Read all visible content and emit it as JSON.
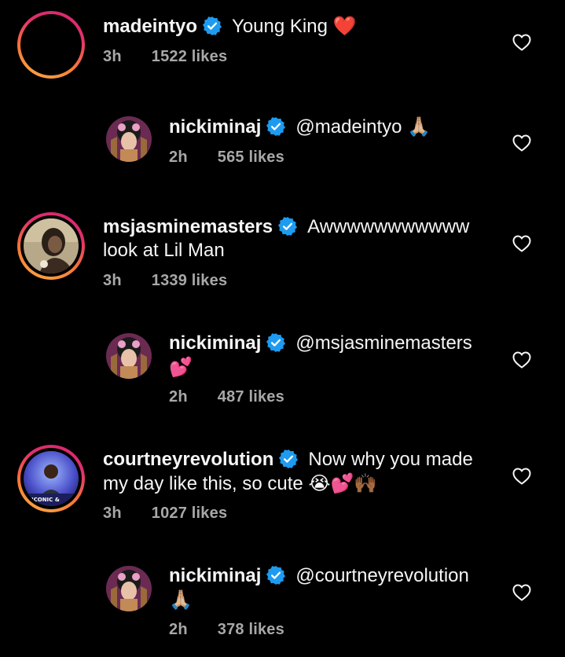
{
  "comments": [
    {
      "username": "madeintyo",
      "text": "Young King",
      "emoji": "❤️",
      "time": "3h",
      "likes": "1522 likes",
      "reply": {
        "username": "nickiminaj",
        "text": "@madeintyo",
        "emoji": "🙏🏼",
        "time": "2h",
        "likes": "565 likes"
      }
    },
    {
      "username": "msjasminemasters",
      "text_line1": "Awwwwwwwwwww",
      "text_line2": "look at Lil Man",
      "time": "3h",
      "likes": "1339 likes",
      "reply": {
        "username": "nickiminaj",
        "text": "@msjasminemasters",
        "emoji": "💕",
        "time": "2h",
        "likes": "487 likes"
      }
    },
    {
      "username": "courtneyrevolution",
      "text_line1": "Now why you made",
      "text_line2": "my day like this, so cute",
      "emoji": "😭💕🙌🏾",
      "time": "3h",
      "likes": "1027 likes",
      "reply": {
        "username": "nickiminaj",
        "text": "@courtneyrevolution",
        "emoji": "🙏🏼",
        "time": "2h",
        "likes": "378 likes"
      }
    }
  ],
  "icons": {
    "verified": "verified-badge-icon",
    "like": "heart-outline-icon"
  },
  "colors": {
    "background": "#000000",
    "text": "#f5f5f5",
    "meta": "#a8a8a8",
    "verified": "#1d9bf0",
    "story_ring_start": "#d6246e",
    "story_ring_end": "#fcaf45"
  }
}
